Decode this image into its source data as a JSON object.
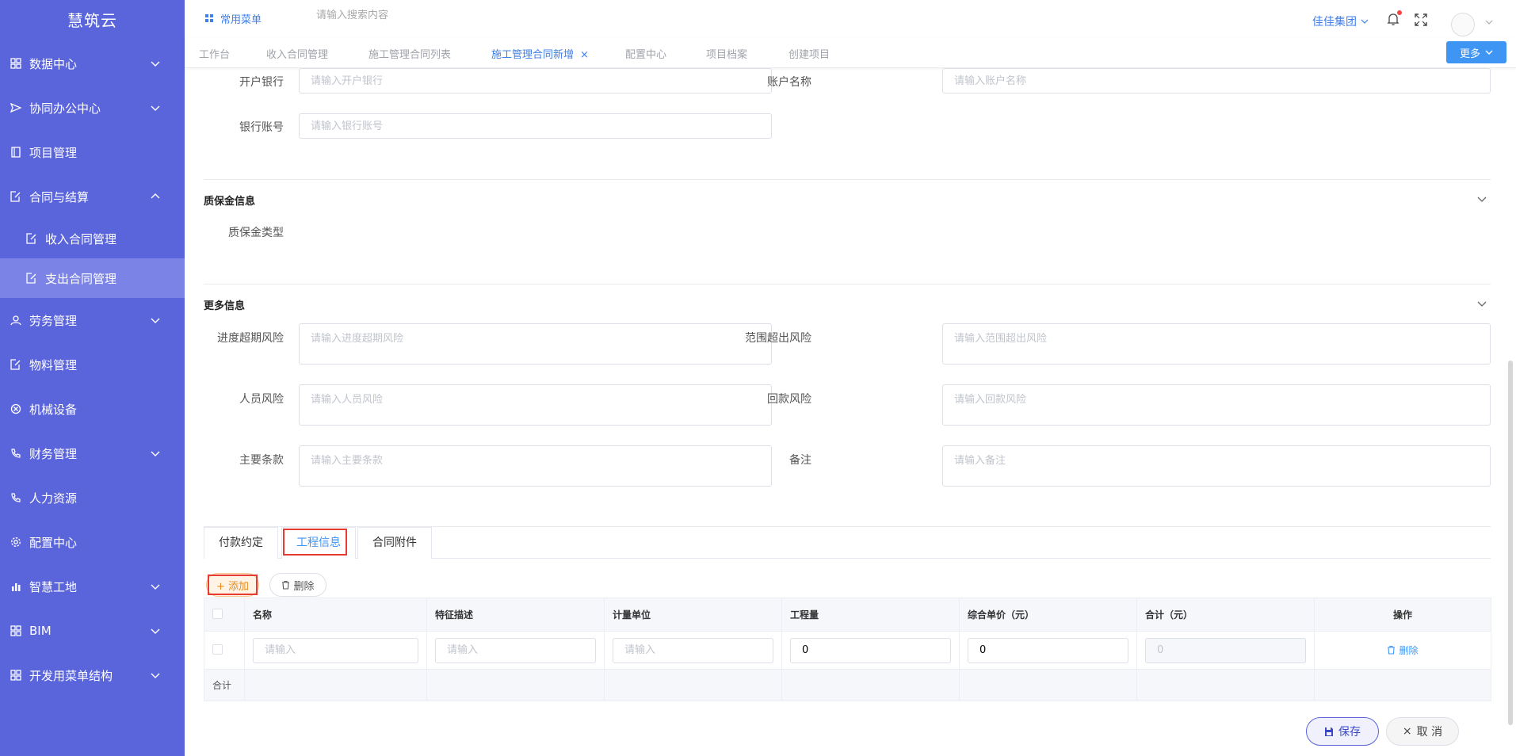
{
  "sidebar": {
    "brand": "慧筑云",
    "items": [
      {
        "label": "数据中心"
      },
      {
        "label": "协同办公中心"
      },
      {
        "label": "项目管理"
      },
      {
        "label": "合同与结算"
      },
      {
        "label": "收入合同管理"
      },
      {
        "label": "支出合同管理"
      },
      {
        "label": "劳务管理"
      },
      {
        "label": "物料管理"
      },
      {
        "label": "机械设备"
      },
      {
        "label": "财务管理"
      },
      {
        "label": "人力资源"
      },
      {
        "label": "配置中心"
      },
      {
        "label": "智慧工地"
      },
      {
        "label": "BIM"
      },
      {
        "label": "开发用菜单结构"
      }
    ]
  },
  "header": {
    "favorites": "常用菜单",
    "search_placeholder": "请输入搜索内容",
    "company": "佳佳集团"
  },
  "tabs": [
    {
      "label": "工作台"
    },
    {
      "label": "收入合同管理"
    },
    {
      "label": "施工管理合同列表"
    },
    {
      "label": "施工管理合同新增"
    },
    {
      "label": "配置中心"
    },
    {
      "label": "项目档案"
    },
    {
      "label": "创建项目"
    }
  ],
  "tab_close": "×",
  "more_label": "更多",
  "form": {
    "bank_label": "开户银行",
    "bank_placeholder": "请输入开户银行",
    "account_name_label": "账户名称",
    "account_name_placeholder": "请输入账户名称",
    "account_no_label": "银行账号",
    "account_no_placeholder": "请输入银行账号",
    "deposit_section": "质保金信息",
    "deposit_type_label": "质保金类型",
    "more_section": "更多信息",
    "progress_risk_label": "进度超期风险",
    "progress_risk_placeholder": "请输入进度超期风险",
    "scope_risk_label": "范围超出风险",
    "scope_risk_placeholder": "请输入范围超出风险",
    "staff_risk_label": "人员风险",
    "staff_risk_placeholder": "请输入人员风险",
    "payment_risk_label": "回款风险",
    "payment_risk_placeholder": "请输入回款风险",
    "terms_label": "主要条款",
    "terms_placeholder": "请输入主要条款",
    "remark_label": "备注",
    "remark_placeholder": "请输入备注"
  },
  "detail_tabs": [
    {
      "label": "付款约定"
    },
    {
      "label": "工程信息"
    },
    {
      "label": "合同附件"
    }
  ],
  "toolbar": {
    "add": "+ 添加",
    "delete": "删除"
  },
  "table": {
    "headers": [
      "名称",
      "特征描述",
      "计量单位",
      "工程量",
      "综合单价（元）",
      "合计（元）",
      "操作"
    ],
    "row": {
      "name_placeholder": "请输入",
      "desc_placeholder": "请输入",
      "unit_placeholder": "请输入",
      "quantity": "0",
      "unit_price": "0",
      "total": "0",
      "action": "删除"
    },
    "total_label": "合计"
  },
  "footer": {
    "save": "保存",
    "cancel": "取 消",
    "cancel_icon": "×"
  },
  "colors": {
    "sidebar": "#5a64db",
    "sidebar_active": "#7b84e6",
    "accent": "#3f95f4",
    "highlight": "#e63a32"
  }
}
